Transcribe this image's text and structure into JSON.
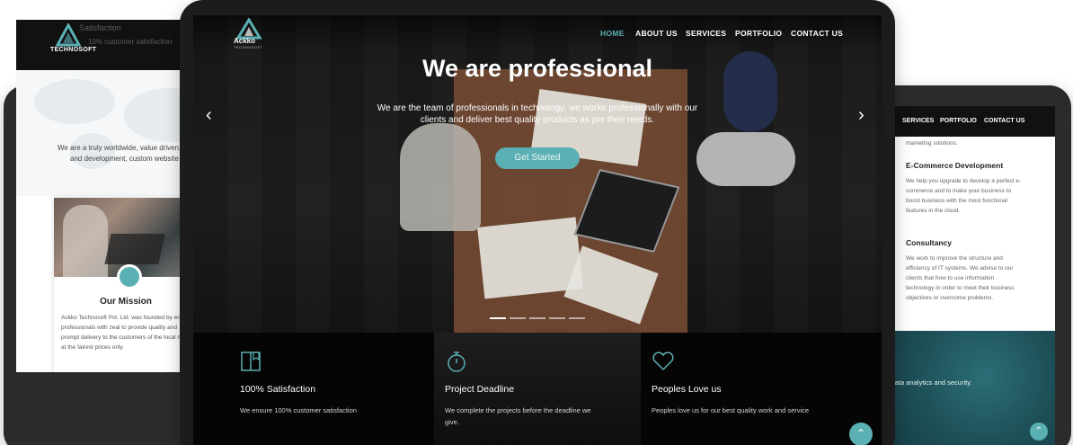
{
  "brand": {
    "name": "Ackko",
    "sub": "TECHNOSOFT",
    "accent": "#5bb0b4"
  },
  "left_screen": {
    "hero_title": "Satisfaction",
    "hero_sub": "10% customer satisfaction",
    "intro_line1": "We are a truly worldwide, value driven, custo",
    "intro_line2": "and development, custom website o",
    "card": {
      "title": "Our Mission",
      "text": "Ackko Technosoft Pvt. Ltd. was founded by en professionals with zeal to provide quality and prompt delivery to the customers of the local market at the fairest prices only."
    }
  },
  "right_screen": {
    "nav": [
      "US",
      "SERVICES",
      "PORTFOLIO",
      "CONTACT US"
    ],
    "top_text": "marketing solutions.",
    "services": [
      {
        "title": "E-Commerce Development",
        "text": "We help you upgrade to develop a perfect e-commerce and to make your business to boost business with the most functional features in the cloud."
      },
      {
        "title": "Consultancy",
        "text": "We work to improve the structure and efficiency of IT systems. We advise to our clients that how to use information technology in order to meet their business objectives or overcome problems."
      }
    ],
    "banner_text": "ity data analytics and security.",
    "scroll_icon": "chevron-up-icon"
  },
  "center_screen": {
    "nav": {
      "items": [
        "HOME",
        "ABOUT US",
        "SERVICES",
        "PORTFOLIO",
        "CONTACT US"
      ],
      "active": "HOME"
    },
    "hero": {
      "title": "We are professional",
      "sub_line1": "We are the team of professionals in technology, we works professionally with our",
      "sub_line2": "clients and deliver best quality products as per their needs.",
      "cta": "Get Started",
      "prev_icon": "chevron-left-icon",
      "next_icon": "chevron-right-icon",
      "slides": 5,
      "active_slide": 1
    },
    "features": [
      {
        "icon": "book-icon",
        "title": "100% Satisfaction",
        "text": "We ensure 100% customer satisfaction"
      },
      {
        "icon": "stopwatch-icon",
        "title": "Project Deadline",
        "text": "We complete the projects before the deadline we give."
      },
      {
        "icon": "heart-icon",
        "title": "Peoples Love us",
        "text": "Peoples love us for our best quality work and service"
      }
    ],
    "scroll_icon": "chevron-up-icon"
  }
}
